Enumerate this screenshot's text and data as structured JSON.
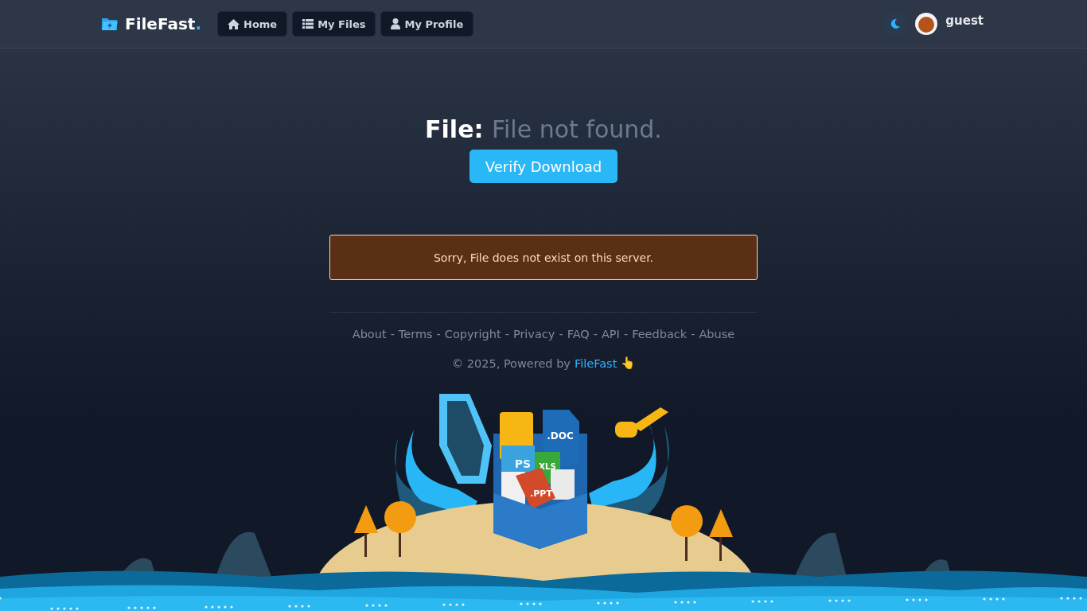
{
  "brand": {
    "name": "FileFast",
    "dot": "."
  },
  "nav": [
    {
      "label": "Home",
      "kind": "home"
    },
    {
      "label": "My Files",
      "kind": "list"
    },
    {
      "label": "My Profile",
      "kind": "user"
    }
  ],
  "user": {
    "name": "guest"
  },
  "heading": {
    "label": "File:",
    "value": "File not found."
  },
  "verify_button": "Verify Download",
  "alert": {
    "message": "Sorry, File does not exist on this server."
  },
  "footer_links": [
    "About",
    "Terms",
    "Copyright",
    "Privacy",
    "FAQ",
    "API",
    "Feedback",
    "Abuse"
  ],
  "footer_separator": "-",
  "copyright": {
    "text": "© 2025, Powered by",
    "link": "FileFast",
    "emoji": "👆"
  },
  "illustration_labels": [
    ".DOC",
    "PS",
    "XLS",
    ".PPT"
  ]
}
